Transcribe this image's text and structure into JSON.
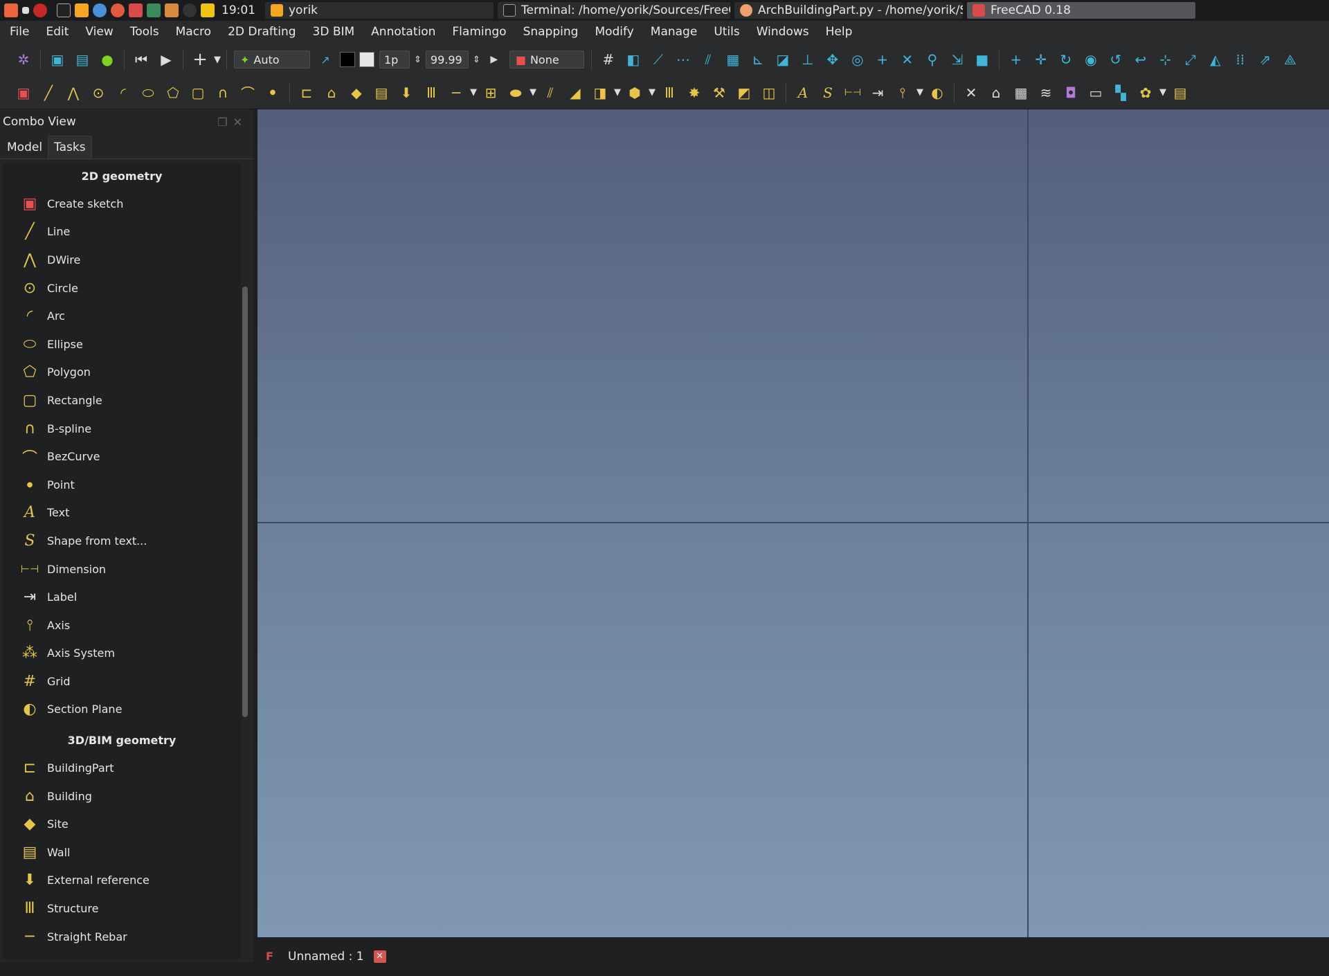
{
  "taskbar": {
    "time": "19:01",
    "tasks": [
      {
        "label": "yorik",
        "icon": "folder-icon",
        "color": "#f5a623"
      },
      {
        "label": "Terminal: /home/yorik/Sources/FreeC...",
        "icon": "terminal-icon",
        "color": "#9aa0a6"
      },
      {
        "label": "ArchBuildingPart.py - /home/yorik/So...",
        "icon": "editor-icon",
        "color": "#f0a070"
      },
      {
        "label": "FreeCAD 0.18",
        "icon": "freecad-icon",
        "color": "#d94a4a",
        "active": true
      }
    ]
  },
  "menubar": [
    "File",
    "Edit",
    "View",
    "Tools",
    "Macro",
    "2D Drafting",
    "3D BIM",
    "Annotation",
    "Flamingo",
    "Snapping",
    "Modify",
    "Manage",
    "Utils",
    "Windows",
    "Help"
  ],
  "toolbar": {
    "construction_mode": "Auto",
    "line_width": "1p",
    "font_size": "99.99",
    "autogroup": "None"
  },
  "combo_view": {
    "title": "Combo View",
    "tabs": [
      "Model",
      "Tasks"
    ],
    "active_tab": "Tasks",
    "sections": [
      {
        "title": "2D geometry",
        "items": [
          {
            "label": "Create sketch",
            "icon": "sketch-icon"
          },
          {
            "label": "Line",
            "icon": "line-icon"
          },
          {
            "label": "DWire",
            "icon": "dwire-icon"
          },
          {
            "label": "Circle",
            "icon": "circle-icon"
          },
          {
            "label": "Arc",
            "icon": "arc-icon"
          },
          {
            "label": "Ellipse",
            "icon": "ellipse-icon"
          },
          {
            "label": "Polygon",
            "icon": "polygon-icon"
          },
          {
            "label": "Rectangle",
            "icon": "rectangle-icon"
          },
          {
            "label": "B-spline",
            "icon": "bspline-icon"
          },
          {
            "label": "BezCurve",
            "icon": "bezcurve-icon"
          },
          {
            "label": "Point",
            "icon": "point-icon"
          },
          {
            "label": "Text",
            "icon": "text-icon"
          },
          {
            "label": "Shape from text...",
            "icon": "shape-from-text-icon"
          },
          {
            "label": "Dimension",
            "icon": "dimension-icon"
          },
          {
            "label": "Label",
            "icon": "label-icon"
          },
          {
            "label": "Axis",
            "icon": "axis-icon"
          },
          {
            "label": "Axis System",
            "icon": "axis-system-icon"
          },
          {
            "label": "Grid",
            "icon": "grid-icon"
          },
          {
            "label": "Section Plane",
            "icon": "section-plane-icon"
          }
        ]
      },
      {
        "title": "3D/BIM geometry",
        "items": [
          {
            "label": "BuildingPart",
            "icon": "building-part-icon"
          },
          {
            "label": "Building",
            "icon": "building-icon"
          },
          {
            "label": "Site",
            "icon": "site-icon"
          },
          {
            "label": "Wall",
            "icon": "wall-icon"
          },
          {
            "label": "External reference",
            "icon": "external-reference-icon"
          },
          {
            "label": "Structure",
            "icon": "structure-icon"
          },
          {
            "label": "Straight Rebar",
            "icon": "straight-rebar-icon"
          }
        ]
      }
    ]
  },
  "document_tab": {
    "label": "Unnamed : 1"
  },
  "colors": {
    "accent": "#e8c547",
    "viewport_top": "#535e7a",
    "viewport_bottom": "#7f99b3"
  }
}
